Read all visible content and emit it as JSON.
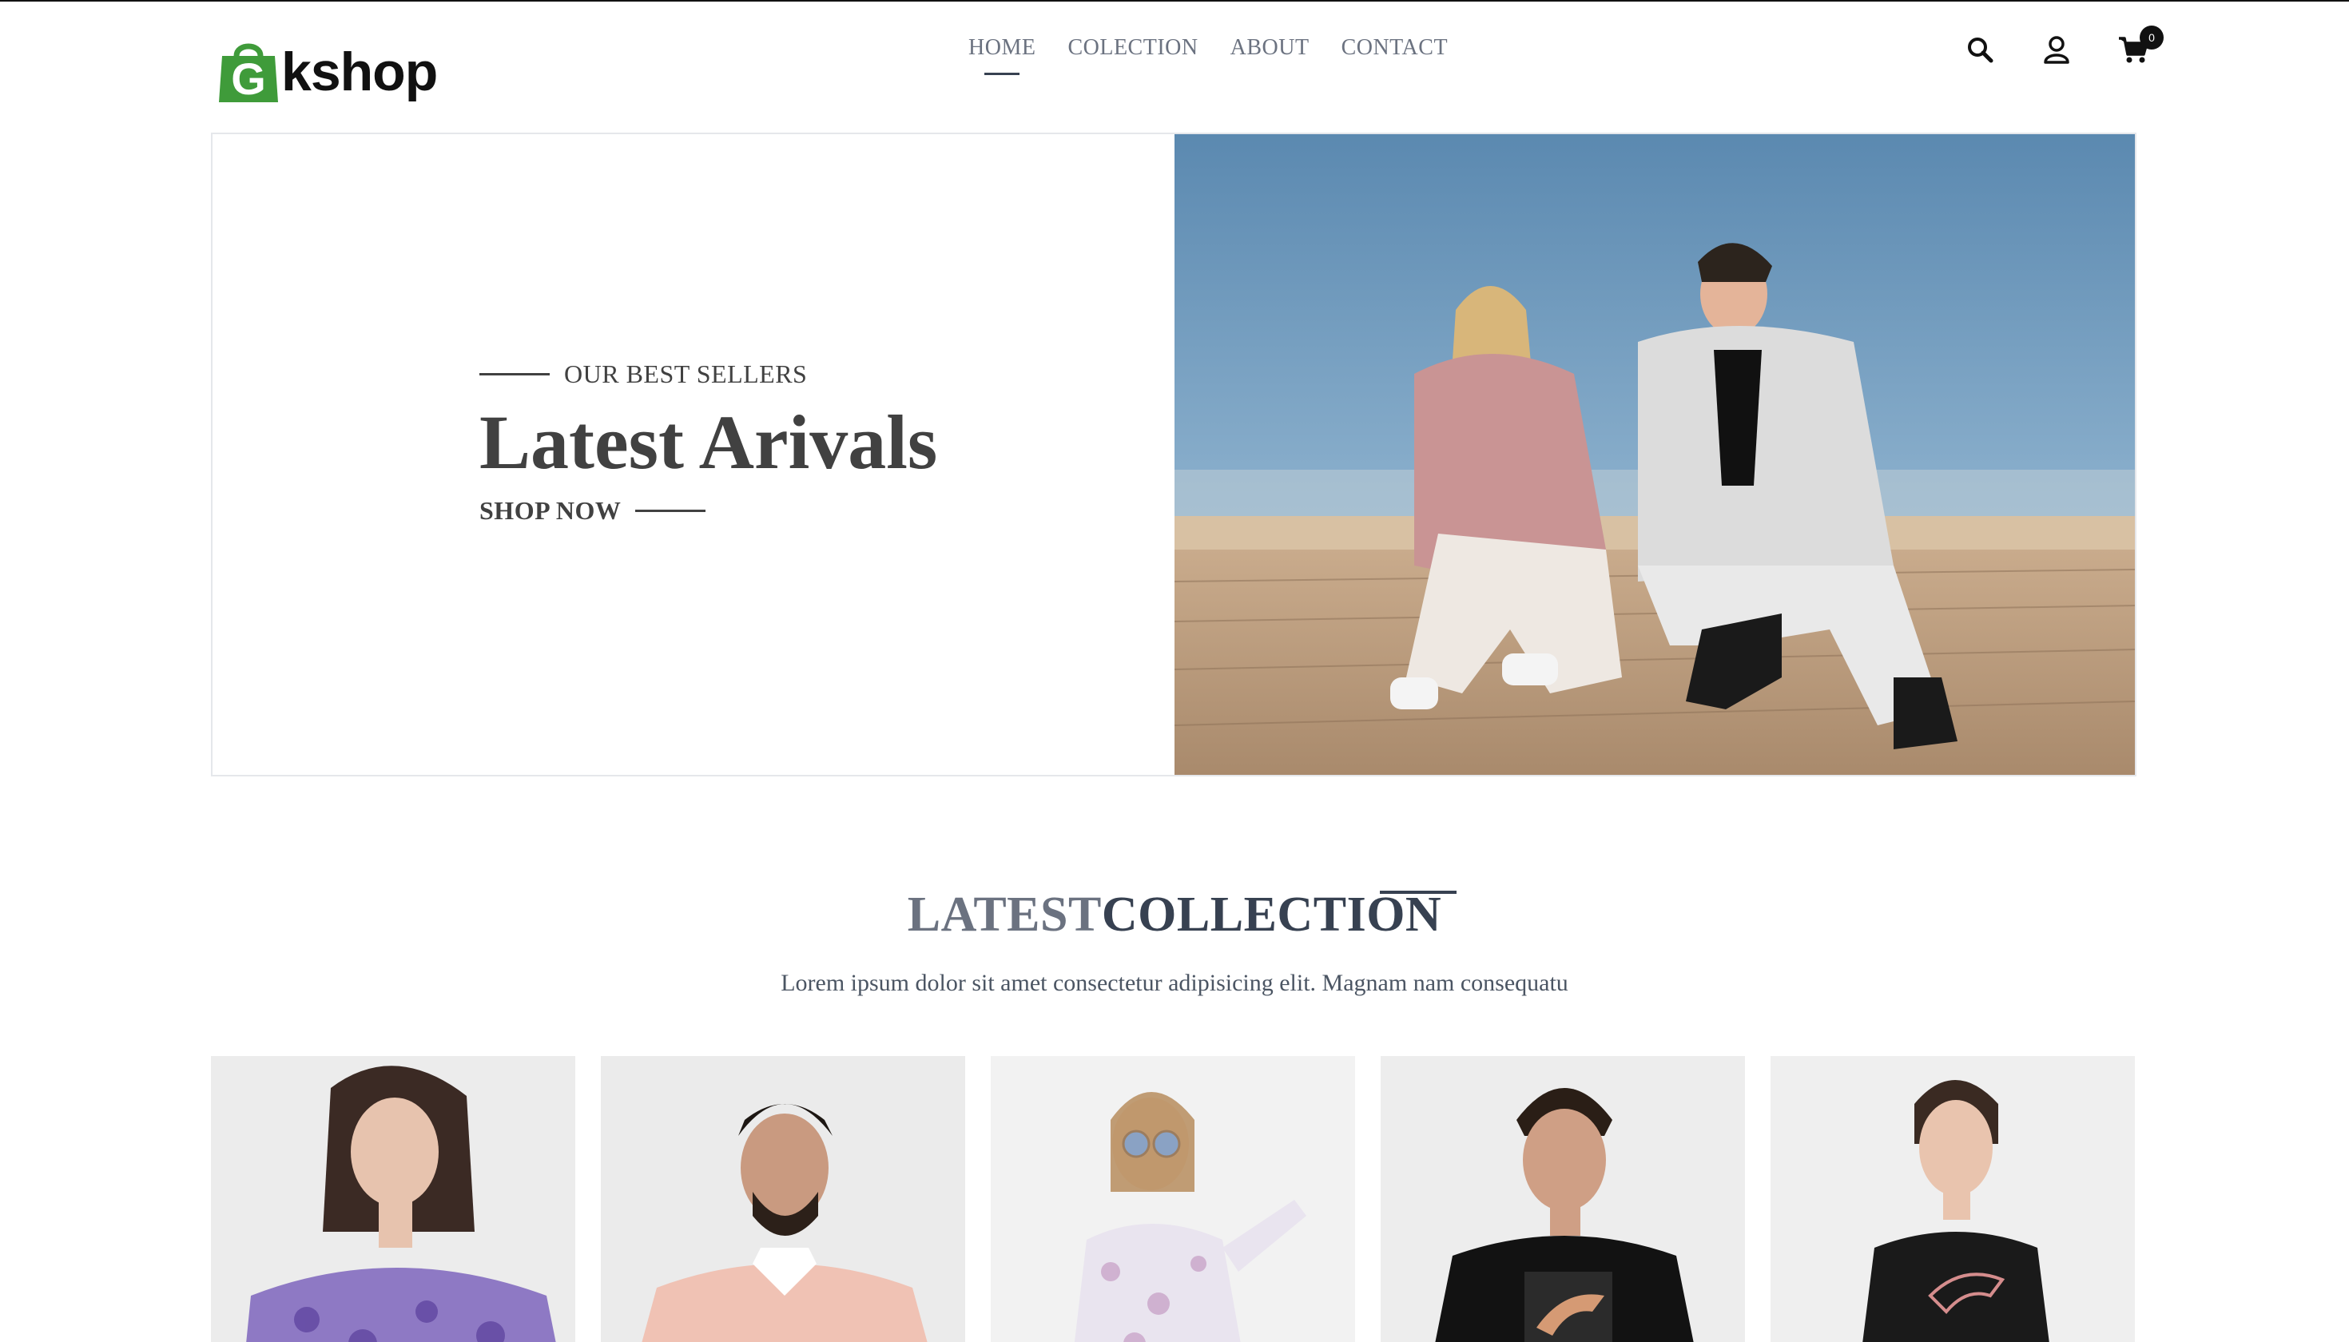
{
  "brand": {
    "logo_text": "kshop",
    "logo_mark": "G",
    "logo_color": "#3f9b3a"
  },
  "nav": {
    "items": [
      {
        "label": "HOME",
        "active": true
      },
      {
        "label": "COLECTION",
        "active": false
      },
      {
        "label": "ABOUT",
        "active": false
      },
      {
        "label": "CONTACT",
        "active": false
      }
    ]
  },
  "header_icons": {
    "search": "search-icon",
    "profile": "user-icon",
    "cart": "cart-icon",
    "cart_count": "0"
  },
  "hero": {
    "eyebrow": "OUR BEST SELLERS",
    "title": "Latest Arivals",
    "cta": "SHOP NOW",
    "image": "two models crouching on a wooden rooftop deck under a blue sky"
  },
  "collection": {
    "title_part1": "LATEST",
    "title_part2": "COLLECTION",
    "subtitle": "Lorem ipsum dolor sit amet consectetur adipisicing elit. Magnam nam consequatu"
  },
  "products": [
    {
      "image": "woman in purple floral off-shoulder top"
    },
    {
      "image": "man in pink polo shirt"
    },
    {
      "image": "girl in floral dress with sunglasses"
    },
    {
      "image": "man in black puma t-shirt"
    },
    {
      "image": "woman in black puma t-shirt"
    }
  ],
  "colors": {
    "accent": "#374151",
    "muted": "#6b7280",
    "border": "#e5e7eb",
    "card_bg": "#f1f1f1"
  }
}
